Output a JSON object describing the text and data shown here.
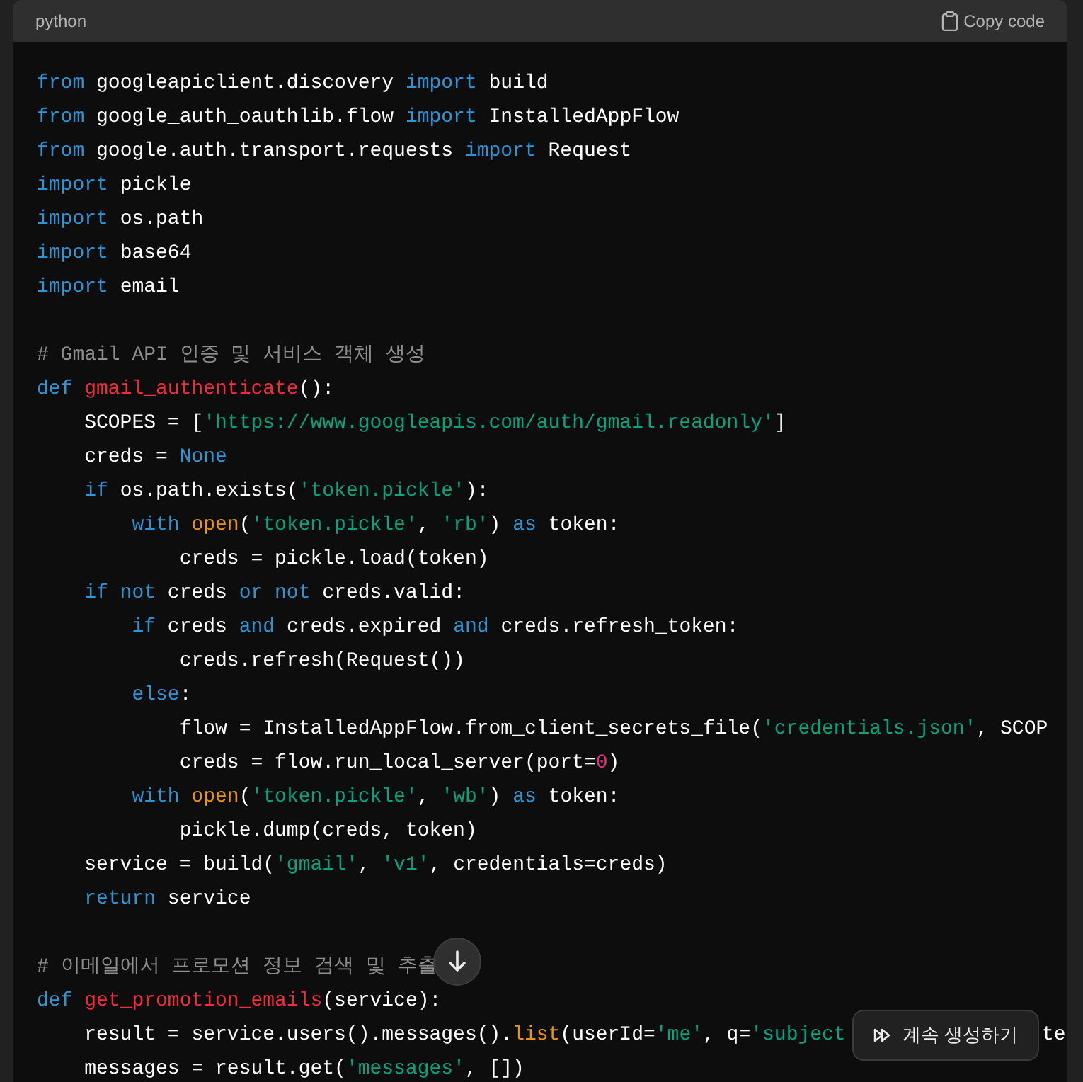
{
  "code_block": {
    "language": "python",
    "copy_button": {
      "label": "Copy code"
    },
    "lines": [
      {
        "tokens": [
          {
            "kind": "keyword",
            "text": "from"
          },
          {
            "kind": "plain",
            "text": " googleapiclient.discovery "
          },
          {
            "kind": "keyword",
            "text": "import"
          },
          {
            "kind": "plain",
            "text": " build"
          }
        ]
      },
      {
        "tokens": [
          {
            "kind": "keyword",
            "text": "from"
          },
          {
            "kind": "plain",
            "text": " google_auth_oauthlib.flow "
          },
          {
            "kind": "keyword",
            "text": "import"
          },
          {
            "kind": "plain",
            "text": " InstalledAppFlow"
          }
        ]
      },
      {
        "tokens": [
          {
            "kind": "keyword",
            "text": "from"
          },
          {
            "kind": "plain",
            "text": " google.auth.transport.requests "
          },
          {
            "kind": "keyword",
            "text": "import"
          },
          {
            "kind": "plain",
            "text": " Request"
          }
        ]
      },
      {
        "tokens": [
          {
            "kind": "keyword",
            "text": "import"
          },
          {
            "kind": "plain",
            "text": " pickle"
          }
        ]
      },
      {
        "tokens": [
          {
            "kind": "keyword",
            "text": "import"
          },
          {
            "kind": "plain",
            "text": " os.path"
          }
        ]
      },
      {
        "tokens": [
          {
            "kind": "keyword",
            "text": "import"
          },
          {
            "kind": "plain",
            "text": " base64"
          }
        ]
      },
      {
        "tokens": [
          {
            "kind": "keyword",
            "text": "import"
          },
          {
            "kind": "plain",
            "text": " email"
          }
        ]
      },
      {
        "kind": "blank"
      },
      {
        "tokens": [
          {
            "kind": "comment",
            "text": "# Gmail API 인증 및 서비스 객체 생성"
          }
        ]
      },
      {
        "tokens": [
          {
            "kind": "keyword",
            "text": "def "
          },
          {
            "kind": "function",
            "text": "gmail_authenticate"
          },
          {
            "kind": "plain",
            "text": "():"
          }
        ]
      },
      {
        "tokens": [
          {
            "kind": "plain",
            "text": "    SCOPES = ["
          },
          {
            "kind": "string",
            "text": "'https://www.googleapis.com/auth/gmail.readonly'"
          },
          {
            "kind": "plain",
            "text": "]"
          }
        ]
      },
      {
        "tokens": [
          {
            "kind": "plain",
            "text": "    creds = "
          },
          {
            "kind": "keyword",
            "text": "None"
          }
        ]
      },
      {
        "tokens": [
          {
            "kind": "keyword",
            "text": "    if"
          },
          {
            "kind": "plain",
            "text": " os.path.exists("
          },
          {
            "kind": "string",
            "text": "'token.pickle'"
          },
          {
            "kind": "plain",
            "text": "):"
          }
        ]
      },
      {
        "tokens": [
          {
            "kind": "keyword",
            "text": "        with "
          },
          {
            "kind": "builtin",
            "text": "open"
          },
          {
            "kind": "plain",
            "text": "("
          },
          {
            "kind": "string",
            "text": "'token.pickle'"
          },
          {
            "kind": "plain",
            "text": ", "
          },
          {
            "kind": "string",
            "text": "'rb'"
          },
          {
            "kind": "plain",
            "text": ") "
          },
          {
            "kind": "keyword",
            "text": "as"
          },
          {
            "kind": "plain",
            "text": " token:"
          }
        ]
      },
      {
        "tokens": [
          {
            "kind": "plain",
            "text": "            creds = pickle.load(token)"
          }
        ]
      },
      {
        "tokens": [
          {
            "kind": "keyword",
            "text": "    if not"
          },
          {
            "kind": "plain",
            "text": " creds "
          },
          {
            "kind": "keyword",
            "text": "or not"
          },
          {
            "kind": "plain",
            "text": " creds.valid:"
          }
        ]
      },
      {
        "tokens": [
          {
            "kind": "keyword",
            "text": "        if"
          },
          {
            "kind": "plain",
            "text": " creds "
          },
          {
            "kind": "keyword",
            "text": "and"
          },
          {
            "kind": "plain",
            "text": " creds.expired "
          },
          {
            "kind": "keyword",
            "text": "and"
          },
          {
            "kind": "plain",
            "text": " creds.refresh_token:"
          }
        ]
      },
      {
        "tokens": [
          {
            "kind": "plain",
            "text": "            creds.refresh(Request())"
          }
        ]
      },
      {
        "tokens": [
          {
            "kind": "keyword",
            "text": "        else"
          },
          {
            "kind": "plain",
            "text": ":"
          }
        ]
      },
      {
        "tokens": [
          {
            "kind": "plain",
            "text": "            flow = InstalledAppFlow.from_client_secrets_file("
          },
          {
            "kind": "string",
            "text": "'credentials.json'"
          },
          {
            "kind": "plain",
            "text": ", SCOP"
          }
        ]
      },
      {
        "tokens": [
          {
            "kind": "plain",
            "text": "            creds = flow.run_local_server(port="
          },
          {
            "kind": "number",
            "text": "0"
          },
          {
            "kind": "plain",
            "text": ")"
          }
        ]
      },
      {
        "tokens": [
          {
            "kind": "keyword",
            "text": "        with "
          },
          {
            "kind": "builtin",
            "text": "open"
          },
          {
            "kind": "plain",
            "text": "("
          },
          {
            "kind": "string",
            "text": "'token.pickle'"
          },
          {
            "kind": "plain",
            "text": ", "
          },
          {
            "kind": "string",
            "text": "'wb'"
          },
          {
            "kind": "plain",
            "text": ") "
          },
          {
            "kind": "keyword",
            "text": "as"
          },
          {
            "kind": "plain",
            "text": " token:"
          }
        ]
      },
      {
        "tokens": [
          {
            "kind": "plain",
            "text": "            pickle.dump(creds, token)"
          }
        ]
      },
      {
        "tokens": [
          {
            "kind": "plain",
            "text": "    service = build("
          },
          {
            "kind": "string",
            "text": "'gmail'"
          },
          {
            "kind": "plain",
            "text": ", "
          },
          {
            "kind": "string",
            "text": "'v1'"
          },
          {
            "kind": "plain",
            "text": ", credentials=creds)"
          }
        ]
      },
      {
        "tokens": [
          {
            "kind": "keyword",
            "text": "    return"
          },
          {
            "kind": "plain",
            "text": " service"
          }
        ]
      },
      {
        "kind": "blank"
      },
      {
        "tokens": [
          {
            "kind": "comment",
            "text": "# 이메일에서 프로모션 정보 검색 및 추출"
          }
        ]
      },
      {
        "tokens": [
          {
            "kind": "keyword",
            "text": "def "
          },
          {
            "kind": "function",
            "text": "get_promotion_emails"
          },
          {
            "kind": "plain",
            "text": "(service):"
          }
        ]
      },
      {
        "tokens": [
          {
            "kind": "plain",
            "text": "    result = service.users().messages()."
          },
          {
            "kind": "builtin",
            "text": "list"
          },
          {
            "kind": "plain",
            "text": "(userId="
          },
          {
            "kind": "string",
            "text": "'me'"
          },
          {
            "kind": "plain",
            "text": ", q="
          },
          {
            "kind": "string",
            "text": "'subject"
          }
        ],
        "continue_button": {
          "label": "계속 생성하기"
        },
        "tail": "te"
      },
      {
        "tokens": [
          {
            "kind": "plain",
            "text": "    messages = result.get("
          },
          {
            "kind": "string",
            "text": "'messages'"
          },
          {
            "kind": "plain",
            "text": ", [])"
          }
        ]
      }
    ]
  }
}
